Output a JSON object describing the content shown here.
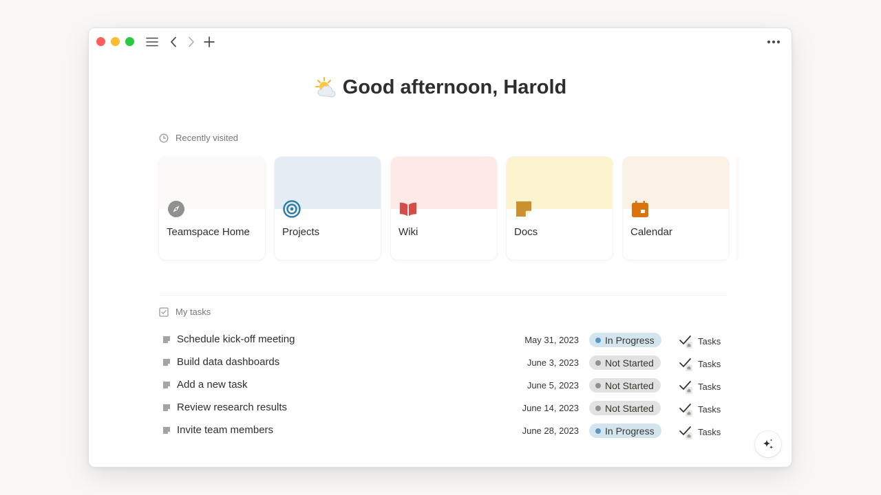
{
  "window": {
    "title": ""
  },
  "greeting": {
    "text": "Good afternoon, Harold",
    "icon": "sun-behind-cloud-emoji"
  },
  "recently_visited": {
    "label": "Recently visited",
    "icon": "clock-icon",
    "cards": [
      {
        "title": "Teamspace Home",
        "icon": "compass-icon",
        "cover": "#fbfaf8",
        "icon_color": "#91918e"
      },
      {
        "title": "Projects",
        "icon": "target-icon",
        "cover": "#e4edf4",
        "icon_color": "#337ea9"
      },
      {
        "title": "Wiki",
        "icon": "book-icon",
        "cover": "#fde9e6",
        "icon_color": "#d44c47"
      },
      {
        "title": "Docs",
        "icon": "sticky-note-icon",
        "cover": "#fbf4cf",
        "icon_color": "#cb912f"
      },
      {
        "title": "Calendar",
        "icon": "calendar-icon",
        "cover": "#fcf1e5",
        "icon_color": "#d9730d"
      }
    ]
  },
  "my_tasks": {
    "label": "My tasks",
    "icon": "checkbox-icon",
    "rows": [
      {
        "name": "Schedule kick-off meeting",
        "date": "May 31, 2023",
        "status": "In Progress",
        "status_kind": "in-progress",
        "database": "Tasks"
      },
      {
        "name": "Build data dashboards",
        "date": "June 3, 2023",
        "status": "Not Started",
        "status_kind": "not-started",
        "database": "Tasks"
      },
      {
        "name": "Add a new task",
        "date": "June 5, 2023",
        "status": "Not Started",
        "status_kind": "not-started",
        "database": "Tasks"
      },
      {
        "name": "Review research results",
        "date": "June 14, 2023",
        "status": "Not Started",
        "status_kind": "not-started",
        "database": "Tasks"
      },
      {
        "name": "Invite team members",
        "date": "June 28, 2023",
        "status": "In Progress",
        "status_kind": "in-progress",
        "database": "Tasks"
      }
    ]
  },
  "toolbar": {
    "menu_icon": "hamburger-menu-icon",
    "back_icon": "chevron-left-icon",
    "forward_icon": "chevron-right-icon",
    "add_icon": "plus-icon",
    "more_icon": "more-horizontal-icon"
  },
  "ai_button": {
    "icon": "sparkle-icon"
  }
}
